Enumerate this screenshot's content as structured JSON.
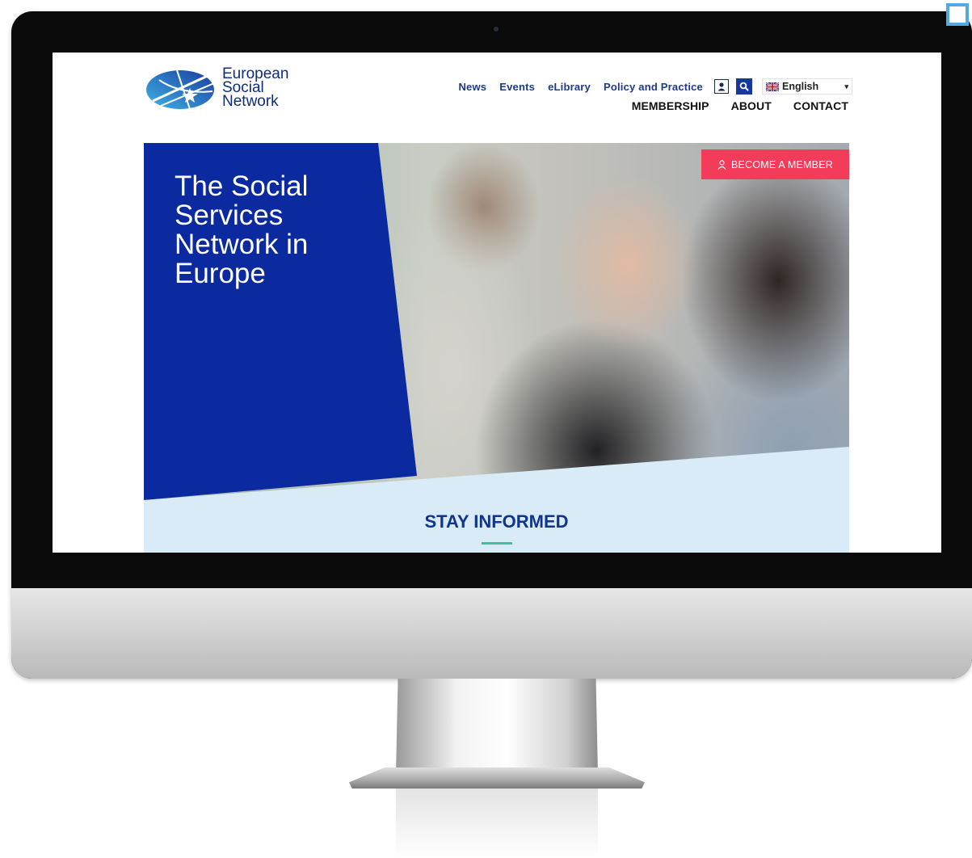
{
  "site": {
    "logo_lines": [
      "European",
      "Social",
      "Network"
    ]
  },
  "topnav": {
    "links": [
      "News",
      "Events",
      "eLibrary",
      "Policy and Practice"
    ],
    "language": "English"
  },
  "mainnav": {
    "links": [
      "MEMBERSHIP",
      "ABOUT",
      "CONTACT"
    ]
  },
  "hero": {
    "title": "The Social Services Network in Europe",
    "cta": "BECOME A MEMBER"
  },
  "section": {
    "title": "STAY INFORMED"
  },
  "icons": {
    "user": "user-icon",
    "search": "search-icon",
    "flag": "uk-flag-icon",
    "caret": "caret-down-icon",
    "member": "person-outline-icon"
  },
  "colors": {
    "brand_blue": "#0c2aa0",
    "nav_blue": "#1b3a8c",
    "cta_red": "#f23c5a",
    "light_band": "#d8ebf7",
    "accent_green": "#3fbf9e"
  }
}
